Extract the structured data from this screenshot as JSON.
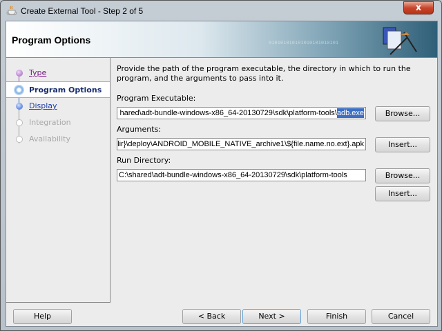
{
  "window": {
    "title": "Create External Tool - Step 2 of 5",
    "close_label": "x"
  },
  "header": {
    "title": "Program Options",
    "binary_text": "010101010101010101010101"
  },
  "nav": {
    "items": [
      {
        "label": "Type",
        "state": "visited"
      },
      {
        "label": "Program Options",
        "state": "current"
      },
      {
        "label": "Display",
        "state": "link"
      },
      {
        "label": "Integration",
        "state": "disabled"
      },
      {
        "label": "Availability",
        "state": "disabled"
      }
    ]
  },
  "content": {
    "description": "Provide the path of the program executable, the directory in which to run the program, and the arguments to pass into it.",
    "program_executable": {
      "label": "Program Executable:",
      "value_prefix": "hared\\adt-bundle-windows-x86_64-20130729\\sdk\\platform-tools\\",
      "value_selected": "adb.exe",
      "browse": "Browse..."
    },
    "arguments": {
      "label": "Arguments:",
      "value": "lir}\\deploy\\ANDROID_MOBILE_NATIVE_archive1\\${file.name.no.ext}.apk",
      "insert": "Insert..."
    },
    "run_directory": {
      "label": "Run Directory:",
      "value": "C:\\shared\\adt-bundle-windows-x86_64-20130729\\sdk\\platform-tools",
      "browse": "Browse...",
      "insert": "Insert..."
    }
  },
  "footer": {
    "help": "Help",
    "back": "< Back",
    "next": "Next >",
    "finish": "Finish",
    "cancel": "Cancel"
  }
}
